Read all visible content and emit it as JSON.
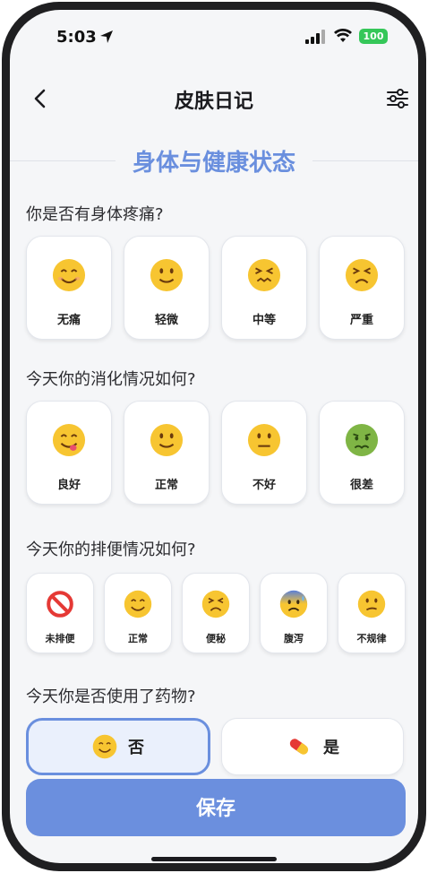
{
  "status": {
    "time": "5:03",
    "battery": "100"
  },
  "header": {
    "title": "皮肤日记"
  },
  "section": {
    "title": "身体与健康状态"
  },
  "questions": [
    {
      "text": "你是否有身体疼痛?",
      "options": [
        {
          "label": "无痛",
          "icon": "smiling-face-icon"
        },
        {
          "label": "轻微",
          "icon": "slight-smile-icon"
        },
        {
          "label": "中等",
          "icon": "confounded-face-icon"
        },
        {
          "label": "严重",
          "icon": "persevering-face-icon"
        }
      ]
    },
    {
      "text": "今天你的消化情况如何?",
      "options": [
        {
          "label": "良好",
          "icon": "yum-face-icon"
        },
        {
          "label": "正常",
          "icon": "slight-smile-icon"
        },
        {
          "label": "不好",
          "icon": "neutral-face-icon"
        },
        {
          "label": "很差",
          "icon": "nauseated-face-icon"
        }
      ]
    },
    {
      "text": "今天你的排便情况如何?",
      "options": [
        {
          "label": "未排便",
          "icon": "prohibited-icon"
        },
        {
          "label": "正常",
          "icon": "smiling-face-icon"
        },
        {
          "label": "便秘",
          "icon": "persevering-face-icon"
        },
        {
          "label": "腹泻",
          "icon": "anxious-sweat-face-icon"
        },
        {
          "label": "不规律",
          "icon": "confused-face-icon"
        }
      ]
    },
    {
      "text": "今天你是否使用了药物?",
      "options": [
        {
          "label": "否",
          "icon": "smiling-face-icon",
          "selected": true
        },
        {
          "label": "是",
          "icon": "pill-icon",
          "selected": false
        }
      ]
    }
  ],
  "save_label": "保存",
  "colors": {
    "accent": "#6a8fde",
    "background": "#f5f6f8",
    "emoji_yellow": "#f7c531"
  }
}
